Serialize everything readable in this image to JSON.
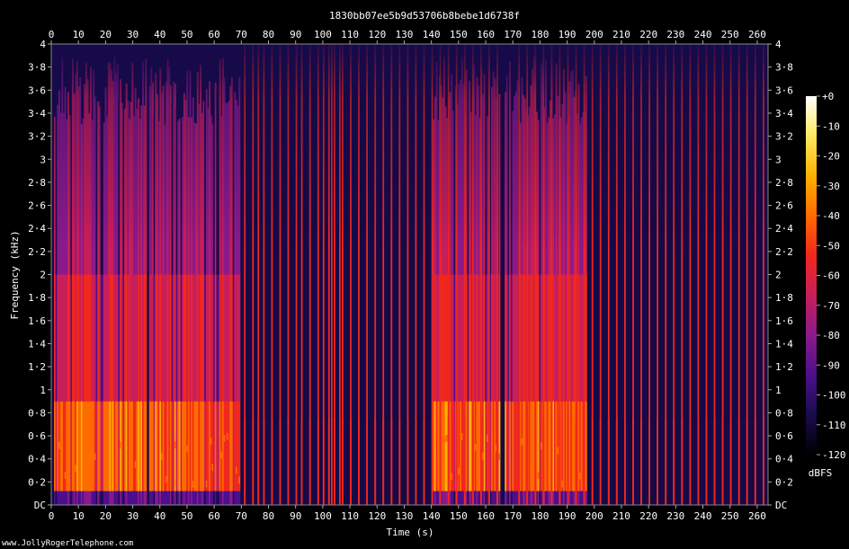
{
  "chart_data": {
    "type": "heatmap",
    "title": "1830bb07ee5b9d53706b8bebe1d6738f",
    "xlabel": "Time (s)",
    "ylabel": "Frequency (kHz)",
    "xlim": [
      0,
      264
    ],
    "ylim": [
      0,
      4
    ],
    "x_ticks": [
      0,
      10,
      20,
      30,
      40,
      50,
      60,
      70,
      80,
      90,
      100,
      110,
      120,
      130,
      140,
      150,
      160,
      170,
      180,
      190,
      200,
      210,
      220,
      230,
      240,
      250,
      260
    ],
    "y_ticks": [
      {
        "v": 0,
        "label": "DC"
      },
      {
        "v": 0.2,
        "label": "0·2"
      },
      {
        "v": 0.4,
        "label": "0·4"
      },
      {
        "v": 0.6,
        "label": "0·6"
      },
      {
        "v": 0.8,
        "label": "0·8"
      },
      {
        "v": 1.0,
        "label": "1"
      },
      {
        "v": 1.2,
        "label": "1·2"
      },
      {
        "v": 1.4,
        "label": "1·4"
      },
      {
        "v": 1.6,
        "label": "1·6"
      },
      {
        "v": 1.8,
        "label": "1·8"
      },
      {
        "v": 2.0,
        "label": "2"
      },
      {
        "v": 2.2,
        "label": "2·2"
      },
      {
        "v": 2.4,
        "label": "2·4"
      },
      {
        "v": 2.6,
        "label": "2·6"
      },
      {
        "v": 2.8,
        "label": "2·8"
      },
      {
        "v": 3.0,
        "label": "3"
      },
      {
        "v": 3.2,
        "label": "3·2"
      },
      {
        "v": 3.4,
        "label": "3·4"
      },
      {
        "v": 3.6,
        "label": "3·6"
      },
      {
        "v": 3.8,
        "label": "3·8"
      },
      {
        "v": 4.0,
        "label": "4"
      }
    ],
    "colorbar": {
      "unit": "dBFS",
      "range": [
        -120,
        0
      ],
      "ticks": [
        {
          "v": 0,
          "label": "+0"
        },
        {
          "v": -10,
          "label": "-10"
        },
        {
          "v": -20,
          "label": "-20"
        },
        {
          "v": -30,
          "label": "-30"
        },
        {
          "v": -40,
          "label": "-40"
        },
        {
          "v": -50,
          "label": "-50"
        },
        {
          "v": -60,
          "label": "-60"
        },
        {
          "v": -70,
          "label": "-70"
        },
        {
          "v": -80,
          "label": "-80"
        },
        {
          "v": -90,
          "label": "-90"
        },
        {
          "v": -100,
          "label": "-100"
        },
        {
          "v": -110,
          "label": "-110"
        },
        {
          "v": -120,
          "label": "-120"
        }
      ],
      "colors": [
        "#000000",
        "#1a0b4d",
        "#4d0f8c",
        "#8a1a8a",
        "#c81e5a",
        "#f0281e",
        "#ff6a00",
        "#ffb000",
        "#ffe860",
        "#ffffff"
      ]
    },
    "speech_segments_s": [
      [
        1,
        35
      ],
      [
        36,
        69
      ],
      [
        140,
        165
      ],
      [
        167,
        197
      ]
    ],
    "click_times_s": [
      71,
      74,
      76,
      78,
      81,
      84,
      87,
      90,
      92,
      95,
      98,
      100,
      102,
      103,
      104,
      106,
      107,
      110,
      113,
      116,
      119,
      122,
      125,
      128,
      131,
      134,
      137,
      140,
      143,
      146,
      149,
      152,
      155,
      158,
      161,
      164,
      172,
      175,
      178,
      181,
      184,
      187,
      190,
      193,
      196,
      199,
      202,
      205,
      208,
      211,
      214,
      217,
      220,
      223,
      226,
      229,
      232,
      235,
      238,
      241,
      244,
      247,
      250,
      253,
      256,
      259,
      262
    ]
  },
  "watermark": "www.JollyRogerTelephone.com"
}
